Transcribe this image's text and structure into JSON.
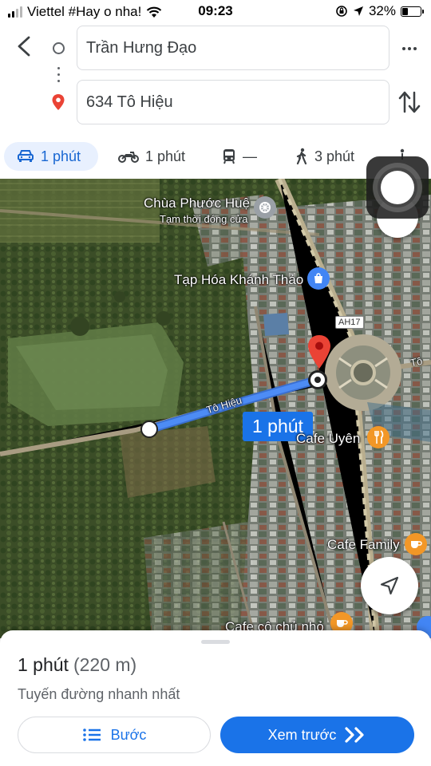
{
  "status_bar": {
    "carrier": "Viettel #Hay o nha!",
    "time": "09:23",
    "battery": "32%",
    "battery_level": 0.32
  },
  "directions": {
    "origin": "Trần Hưng Đạo",
    "destination": "634 Tô Hiệu"
  },
  "modes": [
    {
      "icon": "car-icon",
      "label": "1 phút",
      "active": true
    },
    {
      "icon": "motorbike-icon",
      "label": "1 phút",
      "active": false
    },
    {
      "icon": "transit-icon",
      "label": "—",
      "active": false
    },
    {
      "icon": "walk-icon",
      "label": "3 phút",
      "active": false
    }
  ],
  "map": {
    "labels": {
      "pagoda": "Chùa Phước Huệ",
      "pagoda_status": "Tạm thời đóng cửa",
      "shop": "Tạp Hóa Khánh Thảo",
      "road_badge": "AH17",
      "road_edge": "Tô",
      "street": "Tô Hiệu",
      "cafe_uyen": "Cafe Uyên",
      "cafe_family": "Cafe Family",
      "cafe_co": "Cafe cô chủ nhỏ"
    },
    "eta_bubble": "1 phút"
  },
  "sheet": {
    "duration": "1 phút",
    "distance": "(220 m)",
    "description": "Tuyến đường nhanh nhất",
    "steps_label": "Bước",
    "preview_label": "Xem trước"
  },
  "colors": {
    "accent": "#1a73e8",
    "route": "#4285f4",
    "pin": "#ea4335",
    "cafe_marker": "#f29727"
  }
}
